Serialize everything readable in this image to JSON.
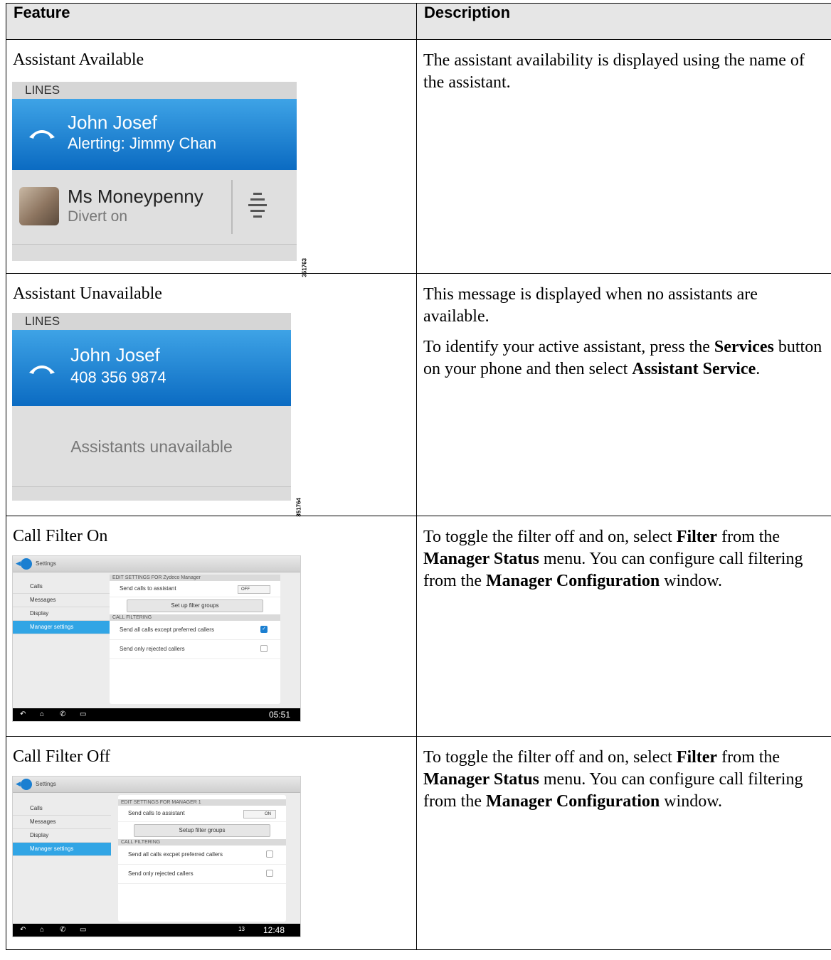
{
  "table": {
    "headers": {
      "feature": "Feature",
      "description": "Description"
    },
    "rows": [
      {
        "feature": "Assistant Available",
        "shot": {
          "lines": "LINES",
          "name": "John Josef",
          "sub": "Alerting: Jimmy Chan",
          "assistant_name": "Ms Moneypenny",
          "assistant_status": "Divert on",
          "fig_id": "351763"
        },
        "desc": [
          "The assistant availability is displayed using the name of the assistant."
        ]
      },
      {
        "feature": "Assistant Unavailable",
        "shot": {
          "lines": "LINES",
          "name": "John Josef",
          "sub": "408 356 9874",
          "unavailable": "Assistants unavailable",
          "fig_id": "351764"
        },
        "desc": {
          "p1": "This message is displayed when no assistants are available.",
          "p2_a": "To identify your active assistant, press the ",
          "p2_b": "Services",
          "p2_c": " button on your phone and then select ",
          "p2_d": "Assistant Service",
          "p2_e": "."
        }
      },
      {
        "feature": "Call Filter On",
        "shot": {
          "title": "Settings",
          "menu": [
            "Calls",
            "Messages",
            "Display",
            "Manager settings"
          ],
          "section1": "EDIT SETTINGS FOR Zydeco Manager",
          "send_calls": "Send calls to assistant",
          "toggle": "OFF",
          "filter_btn": "Set up filter groups",
          "section2": "CALL FILTERING",
          "opt1": "Send all calls except preferred callers",
          "opt2": "Send only rejected callers",
          "clock": "05:51"
        },
        "desc": {
          "a": "To toggle the filter off and on, select ",
          "b": "Filter",
          "c": " from the ",
          "d": "Manager Status",
          "e": " menu. You can configure call filtering from the ",
          "f": "Manager Configuration",
          "g": " window."
        }
      },
      {
        "feature": "Call Filter Off",
        "shot": {
          "title": "Settings",
          "menu": [
            "Calls",
            "Messages",
            "Display",
            "Manager settings"
          ],
          "section1": "EDIT SETTINGS FOR MANAGER 1",
          "send_calls": "Send calls to assistant",
          "toggle": "ON",
          "filter_btn": "Setup filter groups",
          "section2": "CALL FILTERING",
          "opt1": "Send all calls excpet preferred callers",
          "opt2": "Send only rejected callers",
          "status_count": "13",
          "clock": "12:48"
        },
        "desc": {
          "a": "To toggle the filter off and on, select ",
          "b": "Filter",
          "c": " from the ",
          "d": "Manager Status",
          "e": " menu. You can configure call filtering from the ",
          "f": "Manager Configuration",
          "g": " window."
        }
      }
    ]
  }
}
